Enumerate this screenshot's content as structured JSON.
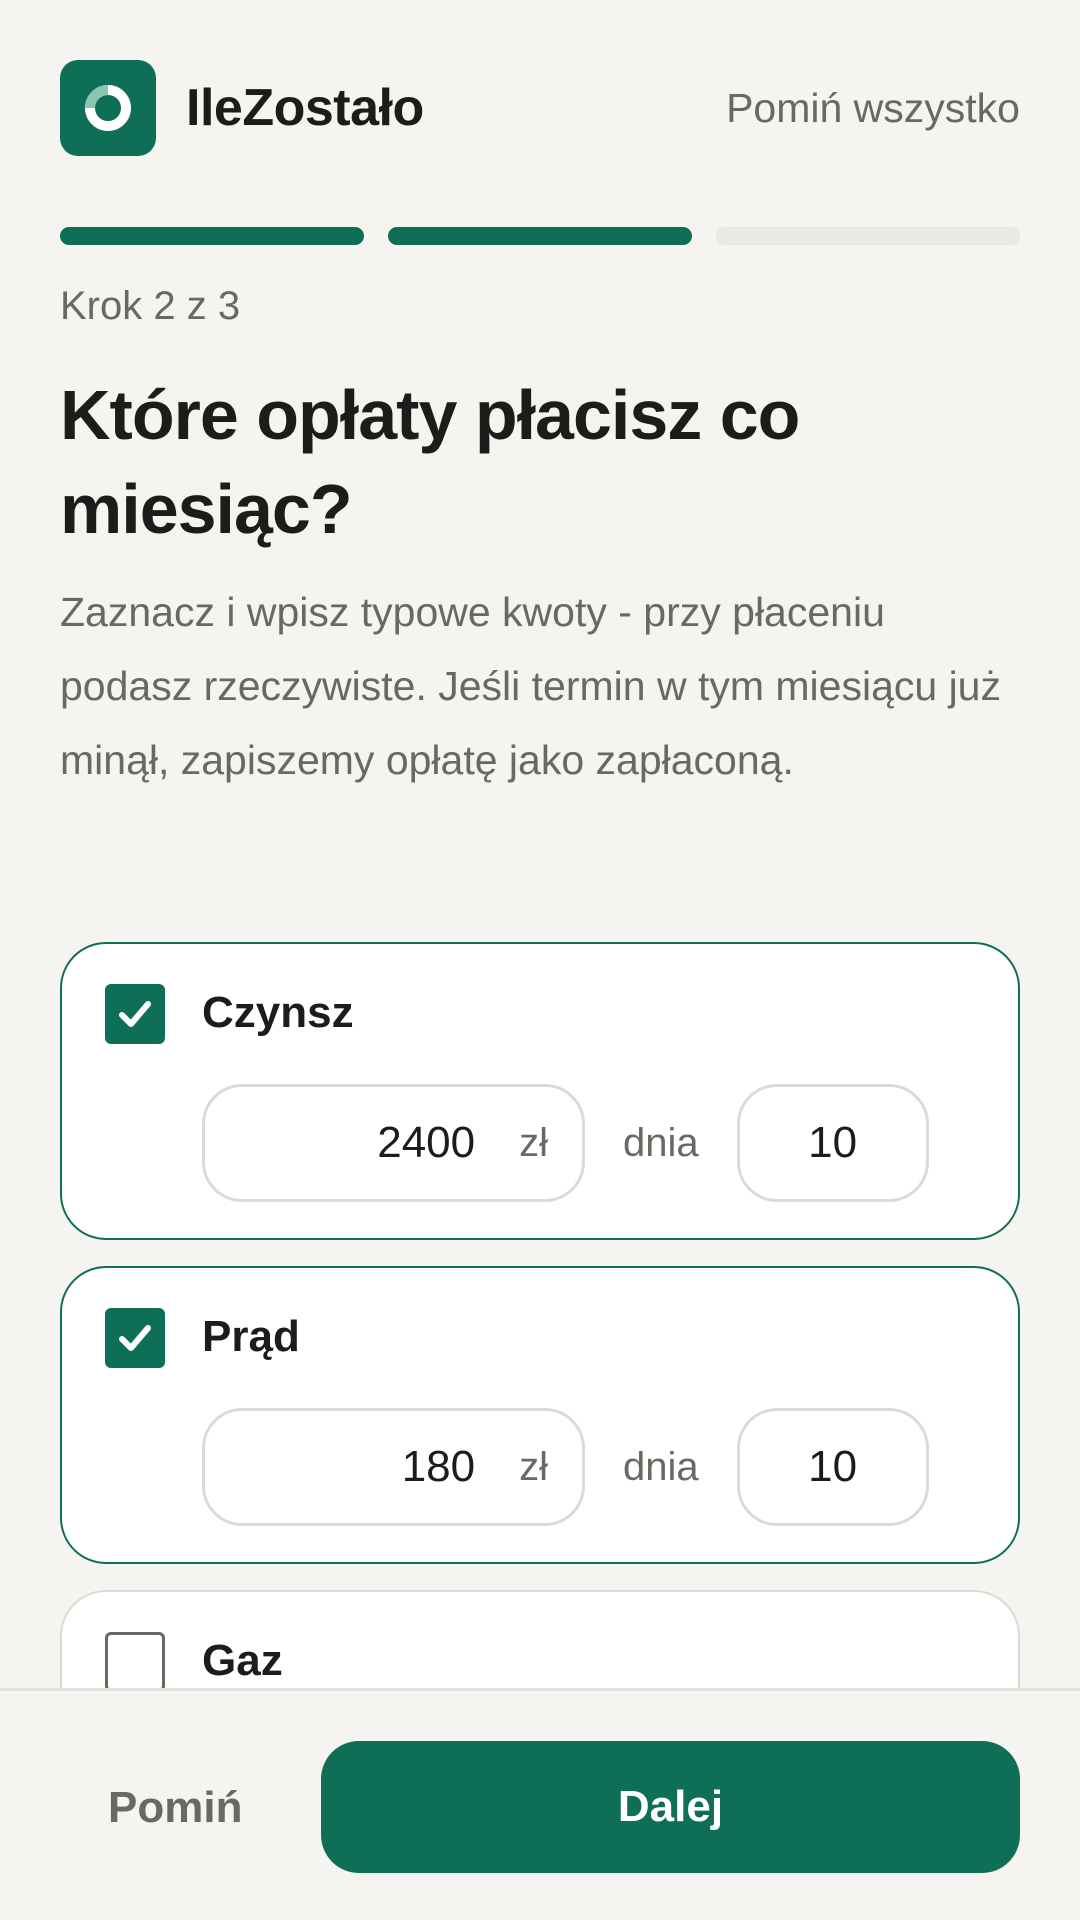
{
  "app": {
    "name": "IleZostało",
    "skip_all_label": "Pomiń wszystko"
  },
  "progress": {
    "current_step": 2,
    "total_steps": 3,
    "step_label": "Krok 2 z 3"
  },
  "main": {
    "title": "Które opłaty płacisz co miesiąc?",
    "description": "Zaznacz i wpisz typowe kwoty - przy płaceniu podasz rzeczywiste. Jeśli termin w tym miesiącu już minął, zapiszemy opłatę jako zapłaconą."
  },
  "bills": [
    {
      "name": "Czynsz",
      "checked": true,
      "amount": "2400",
      "currency": "zł",
      "day_label": "dnia",
      "day": "10"
    },
    {
      "name": "Prąd",
      "checked": true,
      "amount": "180",
      "currency": "zł",
      "day_label": "dnia",
      "day": "10"
    },
    {
      "name": "Gaz",
      "checked": false
    }
  ],
  "footer": {
    "skip_label": "Pomiń",
    "next_label": "Dalej"
  },
  "colors": {
    "accent": "#0f6e56",
    "background": "#f5f4f0",
    "muted_text": "#6a6862",
    "border": "#dcdad4",
    "progress_inactive": "#ebe9e4"
  },
  "icons": {
    "logo": "ring-logo-icon",
    "checkbox_checked": "checkmark-icon"
  }
}
